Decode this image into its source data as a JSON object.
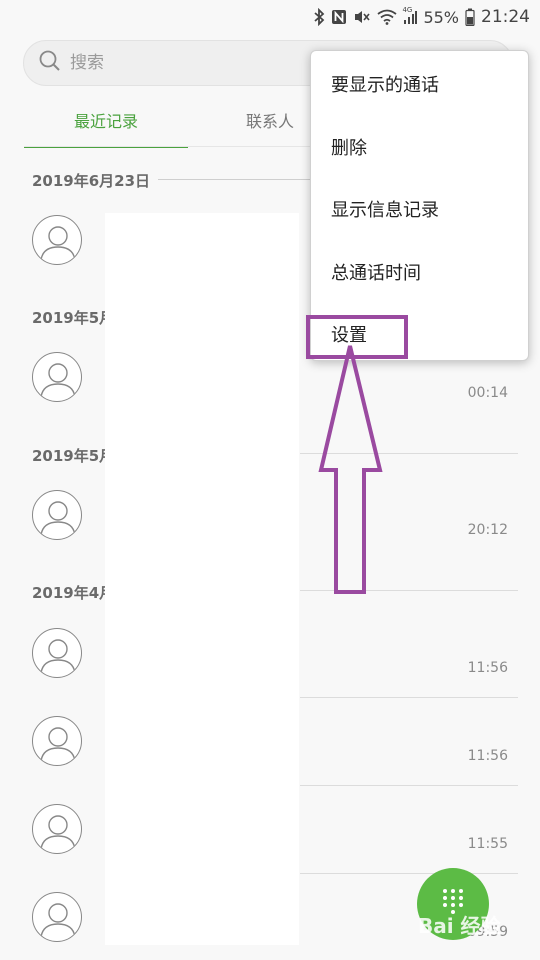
{
  "status": {
    "battery": "55%",
    "time": "21:24",
    "signal_label": "4G"
  },
  "search": {
    "placeholder": "搜索"
  },
  "tabs": [
    {
      "label": "最近记录"
    },
    {
      "label": "联系人"
    }
  ],
  "groups": [
    {
      "date": "2019年6月23日"
    },
    {
      "date": "2019年5月"
    },
    {
      "date": "2019年5月"
    },
    {
      "date": "2019年4月"
    }
  ],
  "times": [
    "00:14",
    "20:12",
    "11:56",
    "11:56",
    "11:55",
    "09:59"
  ],
  "menu": {
    "items": [
      "要显示的通话",
      "删除",
      "显示信息记录",
      "总通话时间",
      "设置"
    ]
  },
  "watermark": "Bai 经验",
  "colors": {
    "accent": "#4aa23e",
    "fab": "#5cbb45",
    "highlight": "#9a4aa0"
  }
}
